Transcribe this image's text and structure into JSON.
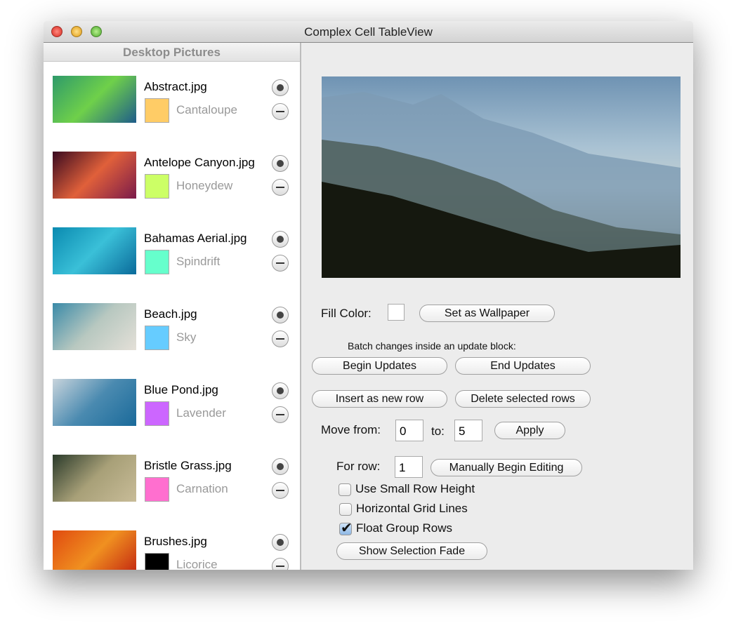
{
  "window": {
    "title": "Complex Cell TableView"
  },
  "sidebar": {
    "header": "Desktop Pictures",
    "rows": [
      {
        "name": "Abstract.jpg",
        "color_name": "Cantaloupe",
        "color": "#ffcc66",
        "thumb": [
          "#2e9a6a",
          "#6fd04a",
          "#1e5c8a"
        ]
      },
      {
        "name": "Antelope Canyon.jpg",
        "color_name": "Honeydew",
        "color": "#ccff66",
        "thumb": [
          "#3a0a20",
          "#e0603a",
          "#7a1a4a"
        ]
      },
      {
        "name": "Bahamas Aerial.jpg",
        "color_name": "Spindrift",
        "color": "#66ffcc",
        "thumb": [
          "#0a8ab0",
          "#3ac0d8",
          "#0a6a9a"
        ]
      },
      {
        "name": "Beach.jpg",
        "color_name": "Sky",
        "color": "#66ccff",
        "thumb": [
          "#3a8aa8",
          "#b8c8c0",
          "#e4e0d8"
        ]
      },
      {
        "name": "Blue Pond.jpg",
        "color_name": "Lavender",
        "color": "#cc66ff",
        "thumb": [
          "#c8d4dc",
          "#4a8ab0",
          "#1a6a9a"
        ]
      },
      {
        "name": "Bristle Grass.jpg",
        "color_name": "Carnation",
        "color": "#ff6fcf",
        "thumb": [
          "#2a3a2a",
          "#a8a078",
          "#c8bc98"
        ]
      },
      {
        "name": "Brushes.jpg",
        "color_name": "Licorice",
        "color": "#000000",
        "thumb": [
          "#e04a10",
          "#f09020",
          "#c02010"
        ]
      }
    ]
  },
  "controls": {
    "fill_color_label": "Fill Color:",
    "fill_color": "#ffffff",
    "set_wallpaper": "Set as Wallpaper",
    "batch_label": "Batch changes inside an update block:",
    "begin_updates": "Begin Updates",
    "end_updates": "End Updates",
    "insert_row": "Insert as new row",
    "delete_rows": "Delete selected rows",
    "move_from_label": "Move from:",
    "move_from": "0",
    "to_label": "to:",
    "move_to": "5",
    "apply": "Apply",
    "for_row_label": "For row:",
    "for_row": "1",
    "manual_edit": "Manually Begin Editing",
    "small_row_height": {
      "label": "Use Small Row Height",
      "checked": false
    },
    "grid_lines": {
      "label": "Horizontal Grid Lines",
      "checked": false
    },
    "float_group_rows": {
      "label": "Float Group Rows",
      "checked": true
    },
    "selection_fade": "Show Selection Fade"
  }
}
